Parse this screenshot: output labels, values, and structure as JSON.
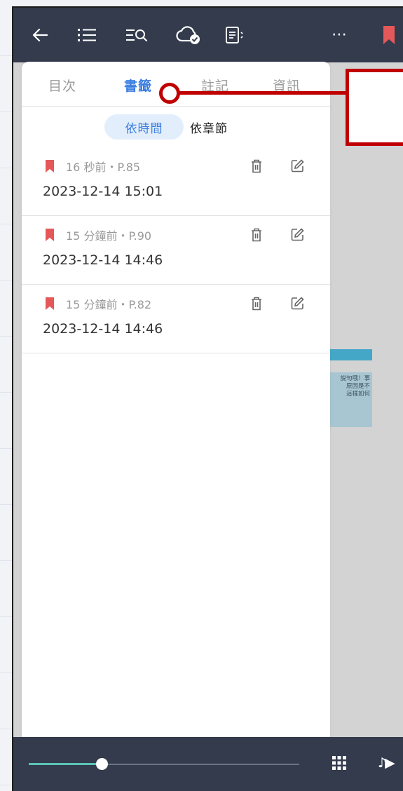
{
  "toolbar": {
    "back_icon": "arrow-left-icon",
    "toc_icon": "list-icon",
    "search_icon": "list-search-icon",
    "sync_icon": "cloud-check-icon",
    "notes_icon": "document-icon",
    "more_label": "⋯",
    "bookmark_icon": "bookmark-icon",
    "bookmark_color": "#e5585a"
  },
  "panel": {
    "tabs": [
      {
        "label": "目次",
        "active": false
      },
      {
        "label": "書籤",
        "active": true
      },
      {
        "label": "註記",
        "active": false
      },
      {
        "label": "資訊",
        "active": false
      }
    ],
    "sort": {
      "by_time": "依時間",
      "by_chapter": "依章節",
      "selected": "依時間"
    },
    "bookmarks": [
      {
        "meta": "16 秒前・P.85",
        "datetime": "2023-12-14 15:01"
      },
      {
        "meta": "15 分鐘前・P.90",
        "datetime": "2023-12-14 14:46"
      },
      {
        "meta": "15 分鐘前・P.82",
        "datetime": "2023-12-14 14:46"
      }
    ]
  },
  "page_preview": {
    "lines": [
      "說句哦！事",
      "原因是不",
      "這樣如何"
    ]
  },
  "progress": {
    "reading_fraction": 0.27
  },
  "bottom": {
    "grid_icon": "grid-icon",
    "audio_label": "♪▶"
  },
  "colors": {
    "accent": "#3b7ee0",
    "bar": "#333b4d",
    "flag": "#e5585a",
    "callout": "#c00000",
    "slider": "#5cc3b5"
  }
}
